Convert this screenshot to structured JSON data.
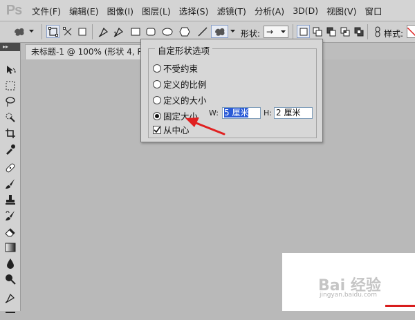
{
  "app": {
    "logo": "Ps"
  },
  "menu": [
    "文件(F)",
    "编辑(E)",
    "图像(I)",
    "图层(L)",
    "选择(S)",
    "滤镜(T)",
    "分析(A)",
    "3D(D)",
    "视图(V)",
    "窗口"
  ],
  "options_bar": {
    "shape_label": "形状:",
    "shape_value": "→",
    "style_label": "样式:"
  },
  "document": {
    "tab_title": "未标题-1 @ 100% (形状 4, R"
  },
  "popup": {
    "title": "自定形状选项",
    "options": [
      {
        "label": "不受约束",
        "selected": false
      },
      {
        "label": "定义的比例",
        "selected": false
      },
      {
        "label": "定义的大小",
        "selected": false
      },
      {
        "label": "固定大小",
        "selected": true
      }
    ],
    "width_label": "W:",
    "width_value": "5 厘米",
    "height_label": "H:",
    "height_value": "2 厘米",
    "from_center_label": "从中心",
    "from_center_checked": true
  },
  "watermark": {
    "text": "Bai 经验",
    "sub": "jingyan.baidu.com"
  },
  "colors": {
    "annotation_arrow": "#e02020",
    "selection_highlight": "#2a5bd7"
  }
}
